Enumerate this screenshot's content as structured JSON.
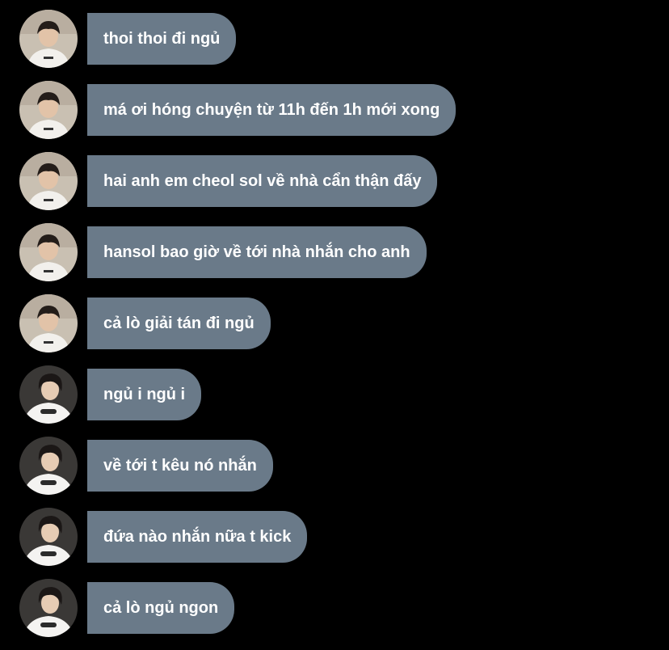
{
  "messages": [
    {
      "avatar": "avatar-a",
      "text": "thoi thoi đi ngủ"
    },
    {
      "avatar": "avatar-a",
      "text": "má ơi hóng chuyện từ 11h đến 1h mới xong"
    },
    {
      "avatar": "avatar-a",
      "text": "hai anh em cheol sol về nhà cẩn thận đấy"
    },
    {
      "avatar": "avatar-a",
      "text": "hansol bao giờ về tới nhà nhắn cho anh"
    },
    {
      "avatar": "avatar-a",
      "text": "cả lò giải tán đi ngủ"
    },
    {
      "avatar": "avatar-b",
      "text": "ngủ i ngủ i"
    },
    {
      "avatar": "avatar-b",
      "text": "về tới t kêu nó nhắn"
    },
    {
      "avatar": "avatar-b",
      "text": "đứa nào nhắn nữa t kick"
    },
    {
      "avatar": "avatar-b",
      "text": "cả lò ngủ ngon"
    }
  ],
  "colors": {
    "background": "#000000",
    "bubble": "#6a7a89",
    "text": "#ffffff"
  }
}
